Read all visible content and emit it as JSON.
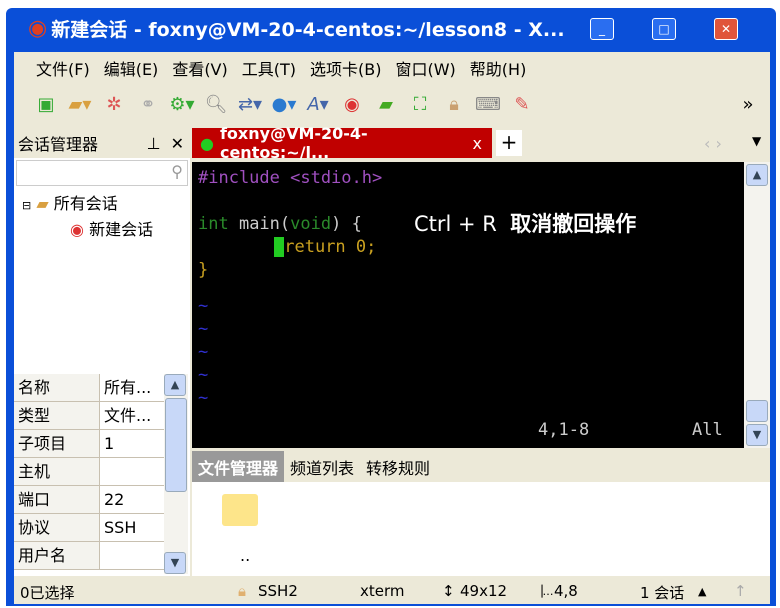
{
  "title": "新建会话 - foxny@VM-20-4-centos:~/lesson8 - X...",
  "menu": [
    "文件(F)",
    "编辑(E)",
    "查看(V)",
    "工具(T)",
    "选项卡(B)",
    "窗口(W)",
    "帮助(H)"
  ],
  "session_panel": {
    "title": "会话管理器",
    "pin": "⊥",
    "close": "✕",
    "tree_root": "所有会话",
    "tree_child": "新建会话"
  },
  "properties": [
    {
      "k": "名称",
      "v": "所有..."
    },
    {
      "k": "类型",
      "v": "文件..."
    },
    {
      "k": "子项目",
      "v": "1"
    },
    {
      "k": "主机",
      "v": ""
    },
    {
      "k": "端口",
      "v": "22"
    },
    {
      "k": "协议",
      "v": "SSH"
    },
    {
      "k": "用户名",
      "v": ""
    }
  ],
  "tab": {
    "label": "foxny@VM-20-4-centos:~/l...",
    "close": "x",
    "add": "+"
  },
  "terminal": {
    "line1": "#include <stdio.h>",
    "line2a": "int",
    " line2b": " main(",
    "line2c": "void",
    "line2d": ") {",
    "line3": "return 0;",
    "line4": "}",
    "tilde": "~",
    "pos": "4,1-8",
    "all": "All",
    "overlay": "Ctrl + R",
    "overlay_cn": "取消撤回操作"
  },
  "bottom_tabs": [
    "文件管理器",
    "频道列表",
    "转移规则"
  ],
  "file_item": "..",
  "status": {
    "selected": "0已选择",
    "protocol": "SSH2",
    "term": "xterm",
    "size": "49x12",
    "cursor": "4,8",
    "sessions": "1 会话"
  }
}
